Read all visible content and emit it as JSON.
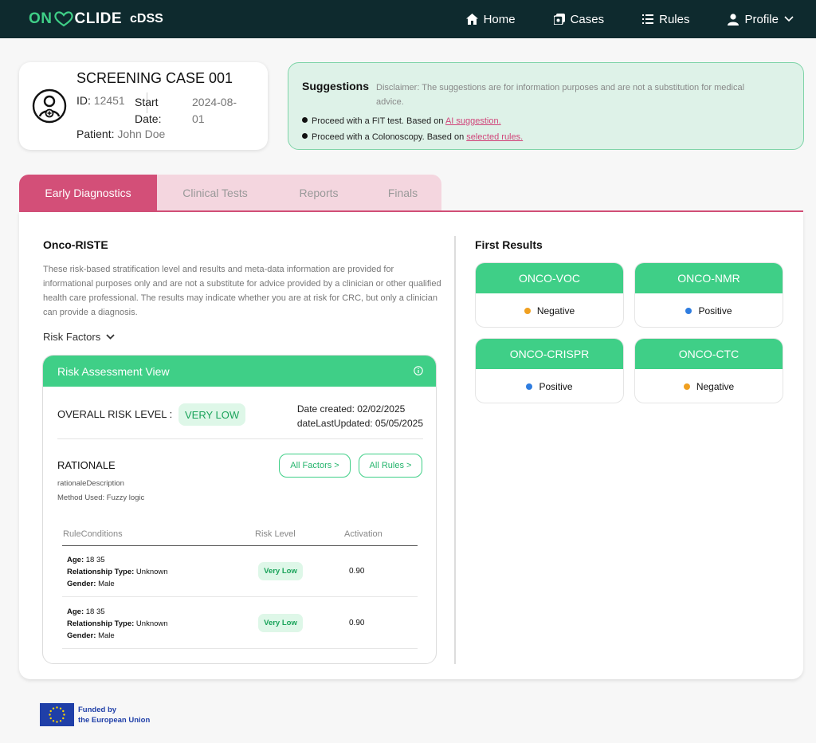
{
  "nav": {
    "logo_part1": "ON",
    "logo_part2": "CLIDE",
    "product": "cDSS",
    "links": [
      {
        "label": "Home",
        "icon": "home-icon"
      },
      {
        "label": "Cases",
        "icon": "cases-icon"
      },
      {
        "label": "Rules",
        "icon": "list-icon"
      },
      {
        "label": "Profile",
        "icon": "user-icon"
      }
    ]
  },
  "case": {
    "title": "SCREENING CASE 001",
    "id_label": "ID:",
    "id_value": "12451",
    "start_label_1": "Start",
    "start_label_2": "Date:",
    "start_value_1": "2024-08-",
    "start_value_2": "01",
    "patient_label": "Patient:",
    "patient_value": "John Doe"
  },
  "suggestions": {
    "title": "Suggestions",
    "disclaimer_line1": "Disclaimer: The suggestions are for information purposes and are not a substitution for medical",
    "disclaimer_line2": "advice.",
    "items": [
      {
        "text": "Proceed with a FIT test. Based on ",
        "link": "AI suggestion."
      },
      {
        "text": "Proceed with a Colonoscopy. Based on ",
        "link": "selected rules."
      }
    ]
  },
  "tabs": [
    "Early Diagnostics",
    "Clinical Tests",
    "Reports",
    "Finals"
  ],
  "riste": {
    "title": "Onco-RISTE",
    "description": "These risk-based stratification level and results and meta-data information are provided for informational purposes only and are not a substitute for advice provided by a clinician or other qualified health care professional. The results may indicate whether you are at risk for CRC, but only a clinician can provide a diagnosis.",
    "risk_factors_label": "Risk Factors"
  },
  "assessment": {
    "title": "Risk Assessment View",
    "overall_label": "OVERALL RISK LEVEL :",
    "overall_value": "VERY LOW",
    "date_created": "Date created: 02/02/2025",
    "date_updated": "dateLastUpdated: 05/05/2025",
    "rationale_title": "RATIONALE",
    "rationale_desc": "rationaleDescription",
    "method": "Method Used: Fuzzy logic",
    "all_factors": "All Factors >",
    "all_rules": "All Rules >",
    "columns": [
      "RuleConditions",
      "Risk Level",
      "Activation"
    ],
    "rows": [
      {
        "age_label": "Age:",
        "age": " 18 35",
        "rel_label": "Relationship Type:",
        "rel": " Unknown",
        "gender_label": "Gender:",
        "gender": " Male",
        "risk": "Very Low",
        "activation": "0.90"
      },
      {
        "age_label": "Age:",
        "age": " 18 35",
        "rel_label": "Relationship Type:",
        "rel": " Unknown",
        "gender_label": "Gender:",
        "gender": " Male",
        "risk": "Very Low",
        "activation": "0.90"
      }
    ]
  },
  "first_results": {
    "title": "First Results",
    "items": [
      {
        "name": "ONCO-VOC",
        "result": "Negative",
        "dot_color": "#f0a020"
      },
      {
        "name": "ONCO-NMR",
        "result": "Positive",
        "dot_color": "#2f7de0"
      },
      {
        "name": "ONCO-CRISPR",
        "result": "Positive",
        "dot_color": "#2f7de0"
      },
      {
        "name": "ONCO-CTC",
        "result": "Negative",
        "dot_color": "#f0a020"
      }
    ]
  },
  "footer": {
    "line1": "Funded by",
    "line2": "the European Union"
  },
  "colors": {
    "nav_bg": "#0e2a2e",
    "brand_green": "#3fcf87",
    "accent_pink": "#d34f78"
  }
}
